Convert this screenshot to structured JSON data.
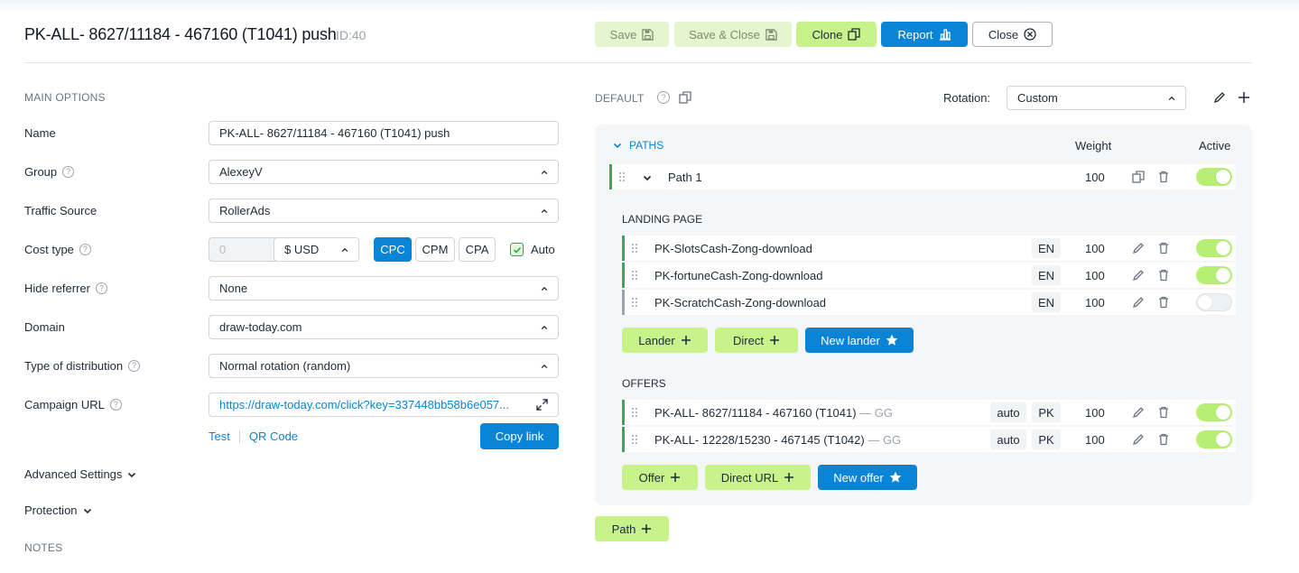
{
  "header": {
    "title": "PK-ALL- 8627/11184 - 467160 (T1041) push",
    "id_label": "ID:40",
    "buttons": {
      "save": "Save",
      "save_close": "Save & Close",
      "clone": "Clone",
      "report": "Report",
      "close": "Close"
    }
  },
  "main_options": {
    "section_label": "MAIN OPTIONS",
    "name_label": "Name",
    "name_value": "PK-ALL- 8627/11184 - 467160 (T1041) push",
    "group_label": "Group",
    "group_value": "AlexeyV",
    "traffic_source_label": "Traffic Source",
    "traffic_source_value": "RollerAds",
    "cost_type_label": "Cost type",
    "cost_placeholder": "0",
    "currency_value": "$  USD",
    "cost_modes": [
      "CPC",
      "CPM",
      "CPA"
    ],
    "cost_mode_selected": "CPC",
    "auto_label": "Auto",
    "hide_referrer_label": "Hide referrer",
    "hide_referrer_value": "None",
    "domain_label": "Domain",
    "domain_value": "draw-today.com",
    "distribution_label": "Type of distribution",
    "distribution_value": "Normal rotation (random)",
    "campaign_url_label": "Campaign URL",
    "campaign_url_value": "https://draw-today.com/click?key=337448bb58b6e057...",
    "test_link": "Test",
    "qr_link": "QR Code",
    "copy_link": "Copy link",
    "advanced_settings": "Advanced Settings",
    "protection": "Protection",
    "notes_label": "NOTES"
  },
  "flow": {
    "default_label": "DEFAULT",
    "rotation_label": "Rotation:",
    "rotation_value": "Custom",
    "paths_label": "PATHS",
    "weight_header": "Weight",
    "active_header": "Active",
    "path": {
      "name": "Path 1",
      "weight": "100",
      "active": true
    },
    "landing_label": "LANDING PAGE",
    "landers": [
      {
        "name": "PK-SlotsCash-Zong-download",
        "lang": "EN",
        "weight": "100",
        "active": true
      },
      {
        "name": "PK-fortuneCash-Zong-download",
        "lang": "EN",
        "weight": "100",
        "active": true
      },
      {
        "name": "PK-ScratchCash-Zong-download",
        "lang": "EN",
        "weight": "100",
        "active": false
      }
    ],
    "lander_buttons": {
      "lander": "Lander",
      "direct": "Direct",
      "new_lander": "New lander"
    },
    "offers_label": "OFFERS",
    "offers": [
      {
        "name": "PK-ALL- 8627/11184 - 467160 (T1041)",
        "network": " — GG",
        "mode": "auto",
        "country": "PK",
        "weight": "100",
        "active": true
      },
      {
        "name": "PK-ALL- 12228/15230 - 467145 (T1042)",
        "network": " — GG",
        "mode": "auto",
        "country": "PK",
        "weight": "100",
        "active": true
      }
    ],
    "offer_buttons": {
      "offer": "Offer",
      "direct_url": "Direct URL",
      "new_offer": "New offer"
    },
    "add_path": "Path"
  },
  "colors": {
    "primary_blue": "#0a84d6",
    "lime": "#c7f38a",
    "active_bar": "#3aa75c",
    "inactive_bar": "#9aa3ad"
  }
}
